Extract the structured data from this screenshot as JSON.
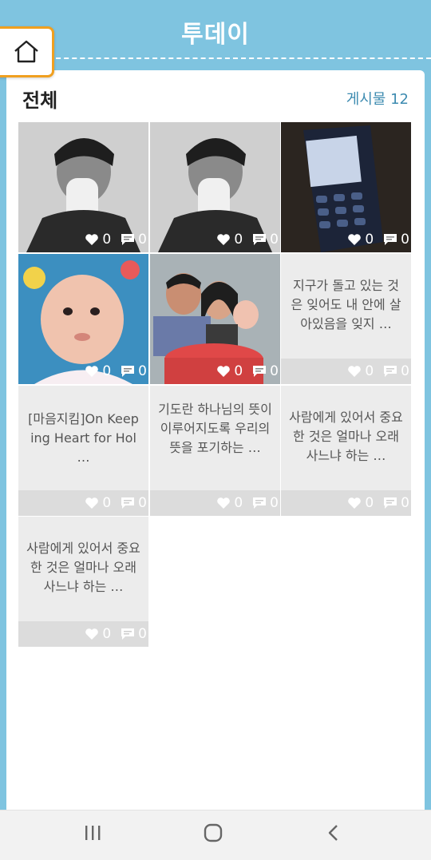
{
  "header": {
    "title": "투데이"
  },
  "section": {
    "title": "전체",
    "post_count": "게시물 12"
  },
  "tiles": [
    {
      "kind": "photo",
      "likes": "0",
      "comments": "0"
    },
    {
      "kind": "photo",
      "likes": "0",
      "comments": "0"
    },
    {
      "kind": "photo",
      "likes": "0",
      "comments": "0"
    },
    {
      "kind": "photo",
      "likes": "0",
      "comments": "0"
    },
    {
      "kind": "photo",
      "likes": "0",
      "comments": "0"
    },
    {
      "kind": "text",
      "text": "지구가 돌고 있는 것은 잊어도 내 안에 살아있음을 잊지 …",
      "likes": "0",
      "comments": "0"
    },
    {
      "kind": "text",
      "text": "[마음지킴]On Keeping Heart for Hol …",
      "likes": "0",
      "comments": "0"
    },
    {
      "kind": "text",
      "text": "기도란 하나님의 뜻이 이루어지도록 우리의 뜻을 포기하는 …",
      "likes": "0",
      "comments": "0"
    },
    {
      "kind": "text",
      "text": "사람에게 있어서 중요한 것은 얼마나 오래 사느냐 하는 …",
      "likes": "0",
      "comments": "0"
    },
    {
      "kind": "text",
      "text": "사람에게 있어서 중요한 것은 얼마나 오래 사느냐 하는 …",
      "likes": "0",
      "comments": "0"
    }
  ],
  "colors": {
    "header_bg": "#7fc4e0",
    "accent": "#f0a020",
    "count_text": "#3d8bb0"
  },
  "icons": {
    "home": "home-icon",
    "like": "heart-icon",
    "comment": "comment-icon",
    "nav": [
      "recent-apps-icon",
      "home-circle-icon",
      "back-icon"
    ]
  }
}
